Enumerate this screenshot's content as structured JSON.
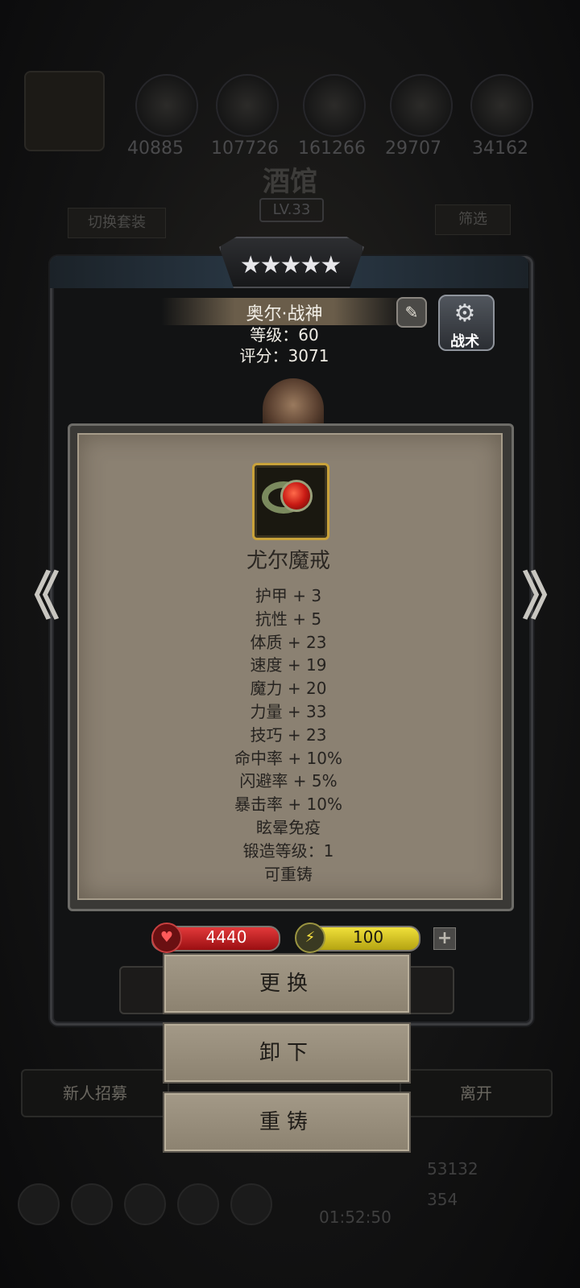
{
  "background": {
    "stat_numbers": [
      "40885",
      "107726",
      "161266",
      "29707",
      "34162"
    ],
    "title": "酒馆",
    "level": "LV.33",
    "switch_outfit_label": "切换套装",
    "filter_label": "筛选",
    "recruit_label": "新人招募",
    "leave_label": "离开",
    "gold": "53132",
    "gems": "354",
    "timer": "01:52:50"
  },
  "hero": {
    "stars": "★★★★★",
    "name": "奥尔·战神",
    "level_line": "等级：60",
    "score_line": "评分：3071",
    "tactic_label": "战术"
  },
  "item": {
    "name": "尤尔魔戒",
    "stats": [
      "护甲 + 3",
      "抗性 + 5",
      "体质 + 23",
      "速度 + 19",
      "魔力 + 20",
      "力量 + 33",
      "技巧 + 23",
      "命中率 + 10%",
      "闪避率 + 5%",
      "暴击率 + 10%",
      "眩晕免疫",
      "锻造等级：1",
      "可重铸"
    ]
  },
  "resources": {
    "hp": "4440",
    "energy": "100",
    "plus": "+"
  },
  "actions": {
    "replace": "更换",
    "unequip": "卸下",
    "reforge": "重铸"
  },
  "nav": {
    "prev": "《",
    "next": "》"
  },
  "colors": {
    "card_bg": "#8b8172",
    "hp_red": "#c81a14",
    "energy_yellow": "#f0e03a",
    "slot_gold": "#c9a23a"
  }
}
